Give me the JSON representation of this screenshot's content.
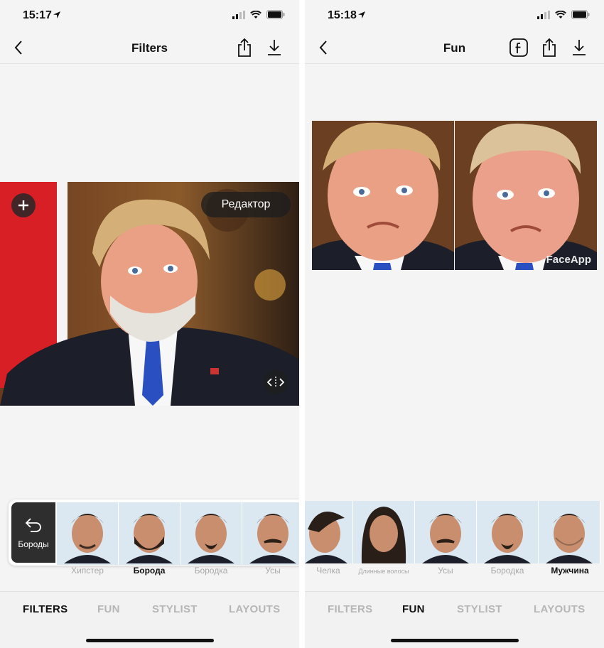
{
  "left": {
    "status": {
      "time": "15:17"
    },
    "nav": {
      "title": "Filters"
    },
    "editor_button": "Редактор",
    "back_card_label": "Бороды",
    "filters": [
      {
        "label": "Хипстер",
        "selected": false
      },
      {
        "label": "Борода",
        "selected": true
      },
      {
        "label": "Бородка",
        "selected": false
      },
      {
        "label": "Усы",
        "selected": false
      }
    ],
    "tabs": [
      {
        "label": "FILTERS",
        "active": true
      },
      {
        "label": "FUN",
        "active": false
      },
      {
        "label": "STYLIST",
        "active": false
      },
      {
        "label": "LAYOUTS",
        "active": false
      }
    ]
  },
  "right": {
    "status": {
      "time": "15:18"
    },
    "nav": {
      "title": "Fun"
    },
    "watermark": "FaceApp",
    "filters": [
      {
        "label": "Челка",
        "selected": false
      },
      {
        "label": "Длинные волосы",
        "selected": false
      },
      {
        "label": "Усы",
        "selected": false
      },
      {
        "label": "Бородка",
        "selected": false
      },
      {
        "label": "Мужчина",
        "selected": true
      }
    ],
    "tabs": [
      {
        "label": "FILTERS",
        "active": false
      },
      {
        "label": "FUN",
        "active": true
      },
      {
        "label": "STYLIST",
        "active": false
      },
      {
        "label": "LAYOUTS",
        "active": false
      }
    ]
  },
  "colors": {
    "accent_tie": "#2a4fc0",
    "suit": "#1c1f29",
    "skin": "#e9a085",
    "hair": "#d4b078"
  },
  "icons": [
    "location-arrow-icon",
    "signal-icon",
    "wifi-icon",
    "battery-icon",
    "back-chevron-icon",
    "share-icon",
    "download-icon",
    "facebook-icon",
    "plus-icon",
    "compare-icon",
    "undo-icon"
  ]
}
